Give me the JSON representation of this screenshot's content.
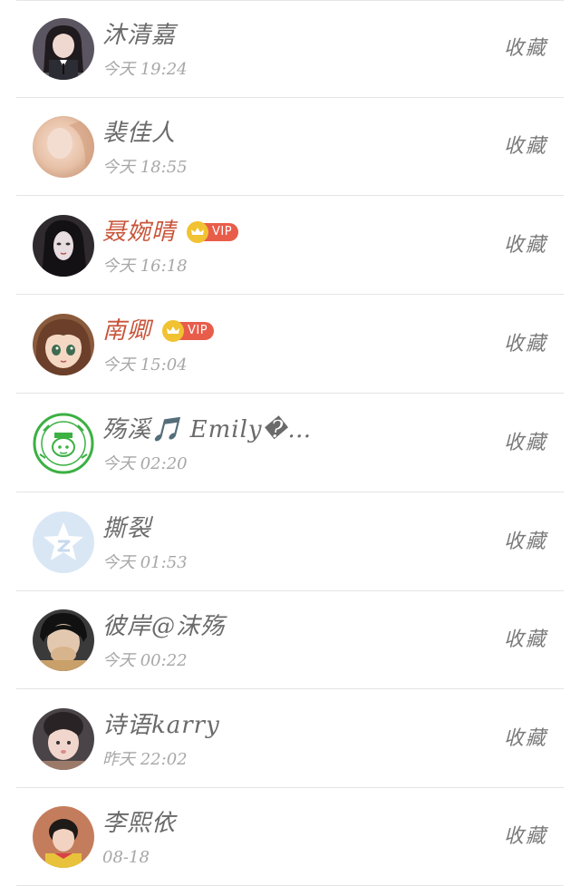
{
  "favorite_label": "收藏",
  "vip_label": "VIP",
  "colors": {
    "vip_name": "#c8553a",
    "vip_badge": "#e85d4a",
    "crown": "#f1c232",
    "normal_name": "#6a6a6a",
    "time": "#a7a7a7",
    "divider": "#e4e4e4"
  },
  "visitors": [
    {
      "name": "沐清嘉",
      "time": "今天 19:24",
      "vip": false,
      "avatar": "avatar-girl-dark-hair"
    },
    {
      "name": "裴佳人",
      "time": "今天 18:55",
      "vip": false,
      "avatar": "avatar-blurred-portrait"
    },
    {
      "name": "聂婉晴",
      "time": "今天 16:18",
      "vip": true,
      "avatar": "avatar-long-hair-girl"
    },
    {
      "name": "南卿",
      "time": "今天 15:04",
      "vip": true,
      "avatar": "avatar-anime-girl"
    },
    {
      "name": "殇溪🎵 Emily�…",
      "time": "今天 02:20",
      "vip": false,
      "avatar": "avatar-green-stamp-logo"
    },
    {
      "name": "撕裂",
      "time": "今天 01:53",
      "vip": false,
      "avatar": "avatar-default-star"
    },
    {
      "name": "彼岸@沫殇",
      "time": "今天 00:22",
      "vip": false,
      "avatar": "avatar-boy-covering-mouth"
    },
    {
      "name": "诗语karry",
      "time": "昨天 22:02",
      "vip": false,
      "avatar": "avatar-toddler"
    },
    {
      "name": "李熙依",
      "time": "08-18",
      "vip": false,
      "avatar": "avatar-child-portrait"
    }
  ]
}
